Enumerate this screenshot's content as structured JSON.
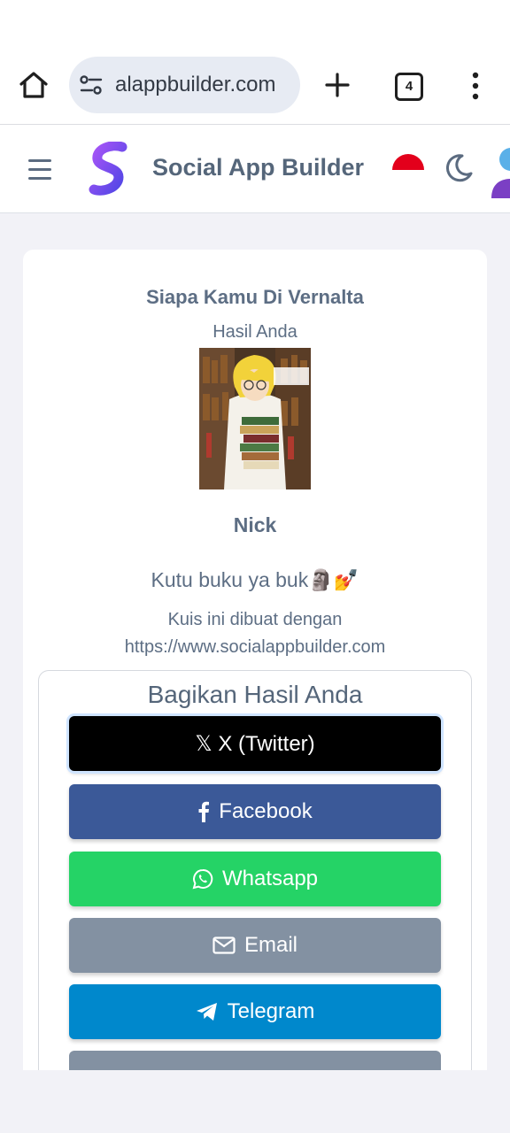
{
  "browser": {
    "url": "alappbuilder.com",
    "tab_count": "4"
  },
  "header": {
    "brand": "Social App Builder"
  },
  "quiz": {
    "title": "Siapa Kamu Di Vernalta",
    "result_label": "Hasil Anda",
    "result_name": "Nick",
    "result_description": "Kutu buku ya buk🗿💅",
    "made_with_line1": "Kuis ini dibuat dengan",
    "made_with_line2": "https://www.socialappbuilder.com"
  },
  "share": {
    "title": "Bagikan Hasil Anda",
    "buttons": {
      "twitter": "𝕏 X (Twitter)",
      "facebook": "Facebook",
      "whatsapp": "Whatsapp",
      "email": "Email",
      "telegram": "Telegram"
    }
  },
  "colors": {
    "twitter": "#000000",
    "facebook": "#3b5998",
    "whatsapp": "#25d366",
    "email": "#8391a2",
    "telegram": "#0088cc",
    "text": "#5d6e84"
  },
  "icons": [
    "home-icon",
    "site-settings-icon",
    "new-tab-icon",
    "tab-switcher-icon",
    "more-menu-icon",
    "menu-icon",
    "brand-logo",
    "indonesia-flag-icon",
    "dark-mode-icon",
    "user-avatar",
    "facebook-icon",
    "whatsapp-icon",
    "email-icon",
    "telegram-icon"
  ]
}
